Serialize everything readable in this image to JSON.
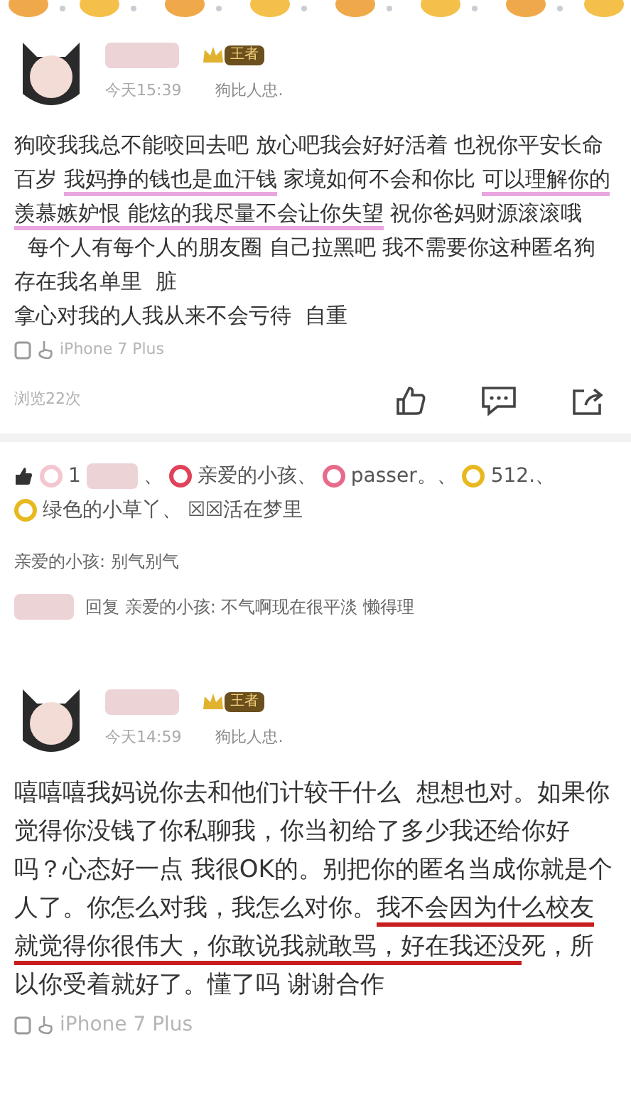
{
  "posts": [
    {
      "time": "今天15:39",
      "tagline": "狗比人忠.",
      "level_badge": "王者",
      "paragraphs": [
        [
          {
            "text": "狗咬我我总不能咬回去吧 放心吧我会好好活着 也祝你平安长命百岁 ",
            "marked": false
          },
          {
            "text": "我妈挣的钱也是血汗钱",
            "marked": true
          },
          {
            "text": " 家境如何不会和你比 ",
            "marked": false
          },
          {
            "text": "可以理解你的羡慕嫉妒恨 能炫的我尽量不会让你失望",
            "marked": true
          },
          {
            "text": " 祝你爸妈财源滚滚哦",
            "marked": false
          }
        ],
        [
          {
            "text": "  每个人有每个人的朋友圈 自己拉黑吧 我不需要你这种匿名狗存在我名单里  脏",
            "marked": false
          }
        ],
        [
          {
            "text": "拿心对我的人我从来不会亏待  自重",
            "marked": false
          }
        ]
      ],
      "kind": "highlighter",
      "device": "iPhone 7 Plus",
      "views": "浏览22次"
    },
    {
      "time": "今天14:59",
      "tagline": "狗比人忠.",
      "level_badge": "王者",
      "paragraphs": [
        [
          {
            "text": "嘻嘻嘻我妈说你去和他们计较干什么  想想也对。如果你觉得你没钱了你私聊我，你当初给了多少我还给你好吗？心态好一点 我很OK的。别把你的匿名当成你就是个人了。你怎么对我，我怎么对你。",
            "marked": false
          },
          {
            "text": "我不会因为什么校友就觉得你很伟大，你敢说我就敢骂，好在我还没",
            "marked": true
          },
          {
            "text": "死，所以你受着就好了。懂了吗 谢谢合作",
            "marked": false
          }
        ]
      ],
      "kind": "pen",
      "device": "iPhone 7 Plus"
    }
  ],
  "likers": [
    {
      "kind": "redacted",
      "color": "#f4c6cf",
      "name": "1",
      "suffix": "、"
    },
    {
      "kind": "named",
      "color": "#e0425a",
      "name": "亲爱的小孩、"
    },
    {
      "kind": "named",
      "color": "#e86a8a",
      "name": "passer。、"
    },
    {
      "kind": "named",
      "color": "#e8b820",
      "name": "512.、"
    },
    {
      "kind": "named",
      "color": "#e8b820",
      "name": "绿色的小草丫、"
    },
    {
      "kind": "named",
      "name": "☒☒活在梦里"
    }
  ],
  "comments": [
    {
      "kind": "comment",
      "author": "亲爱的小孩:",
      "text": "别气别气"
    },
    {
      "kind": "reply",
      "verb": "回复",
      "author": "亲爱的小孩:",
      "text": "不气啊现在很平淡 懒得理"
    }
  ]
}
